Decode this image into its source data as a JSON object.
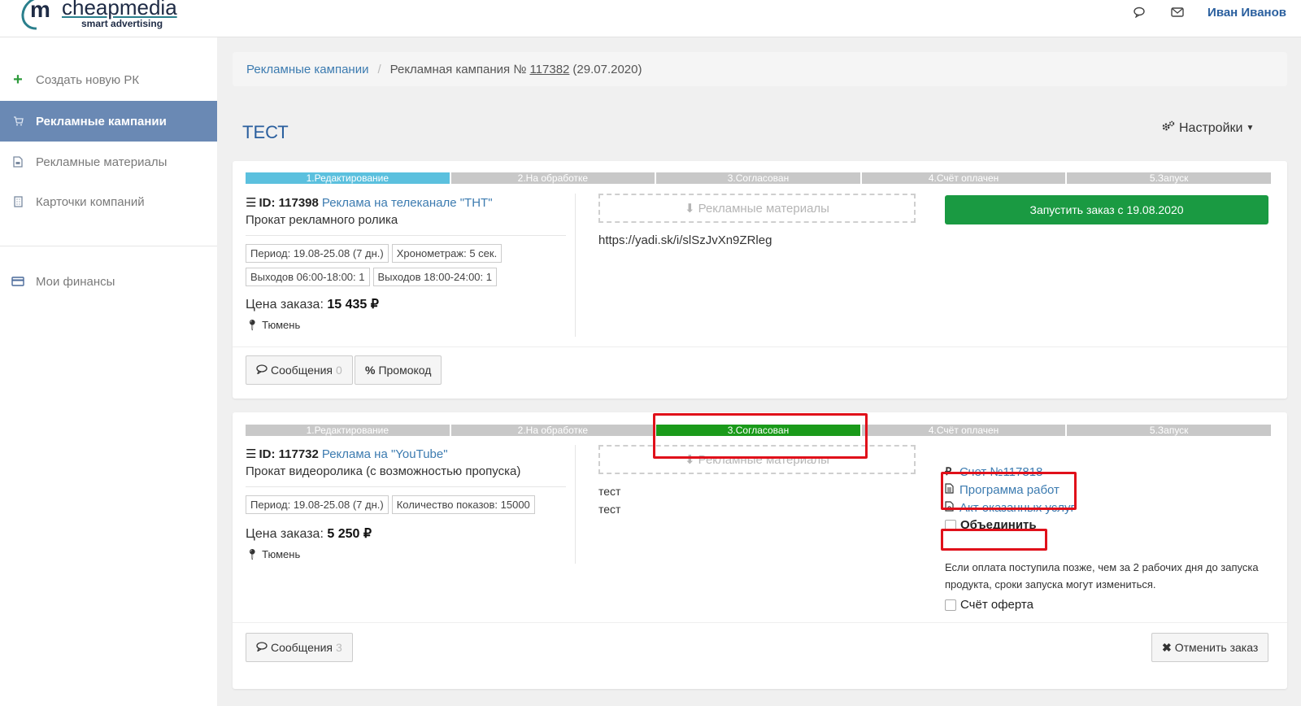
{
  "header": {
    "logo_letter": "m",
    "logo_word": "cheapmedia",
    "logo_sub": "smart advertising",
    "user_name": "Иван Иванов",
    "icons": [
      "messages-icon",
      "mail-icon"
    ]
  },
  "sidebar": {
    "items": [
      {
        "label": "Создать новую РК",
        "icon": "plus-icon"
      },
      {
        "label": "Рекламные кампании",
        "icon": "cart-icon"
      },
      {
        "label": "Рекламные материалы",
        "icon": "file-icon"
      },
      {
        "label": "Карточки компаний",
        "icon": "building-icon"
      },
      {
        "label": "Мои финансы",
        "icon": "card-icon"
      }
    ]
  },
  "breadcrumb": {
    "root": "Рекламные кампании",
    "current_prefix": "Рекламная кампания №",
    "current_number": "117382",
    "current_date": "(29.07.2020)"
  },
  "page": {
    "title": "ТЕСТ",
    "settings_label": "Настройки"
  },
  "steps": [
    "1.Редактирование",
    "2.На обработке",
    "3.Согласован",
    "4.Счёт оплачен",
    "5.Запуск"
  ],
  "orders": [
    {
      "id_label": "ID: 117398",
      "title": "Реклама на телеканале \"ТНТ\"",
      "subtitle": "Прокат рекламного ролика",
      "tags": [
        "Период: 19.08-25.08 (7 дн.)",
        "Хронометраж: 5 сек.",
        "Выходов 06:00-18:00: 1",
        "Выходов 18:00-24:00: 1"
      ],
      "price_label": "Цена заказа:",
      "price_value": "15 435 ₽",
      "city": "Тюмень",
      "materials_label": "Рекламные материалы",
      "link": "https://yadi.sk/i/slSzJvXn9ZRleg",
      "launch_label": "Запустить заказ с 19.08.2020",
      "messages_label": "Сообщения",
      "messages_count": "0",
      "promo_label": "Промокод"
    },
    {
      "id_label": "ID: 117732",
      "title": "Реклама на \"YouTube\"",
      "subtitle": "Прокат видеоролика (с возможностью пропуска)",
      "tags": [
        "Период: 19.08-25.08 (7 дн.)",
        "Количество показов: 15000"
      ],
      "price_label": "Цена заказа:",
      "price_value": "5 250 ₽",
      "city": "Тюмень",
      "materials_label": "Рекламные материалы",
      "text_link": "тест",
      "text_plain": "тест",
      "invoice_label": "Счет №117818",
      "program_label": "Программа работ",
      "act_label": "Акт оказанных услуг",
      "merge_label": "Объединить",
      "notice": "Если оплата поступила позже, чем за 2 рабочих дня до запуска продукта, сроки запуска могут измениться.",
      "offer_label": "Счёт оферта",
      "messages_label": "Сообщения",
      "messages_count": "3",
      "cancel_label": "Отменить заказ"
    }
  ],
  "colors": {
    "accent": "#3c7bb0",
    "sidebar_active": "#6a89b4",
    "step_active_edit": "#5bc0de",
    "step_active_approved": "#1a9a1a",
    "launch_button": "#1a9a42",
    "highlight": "#e0101a"
  }
}
